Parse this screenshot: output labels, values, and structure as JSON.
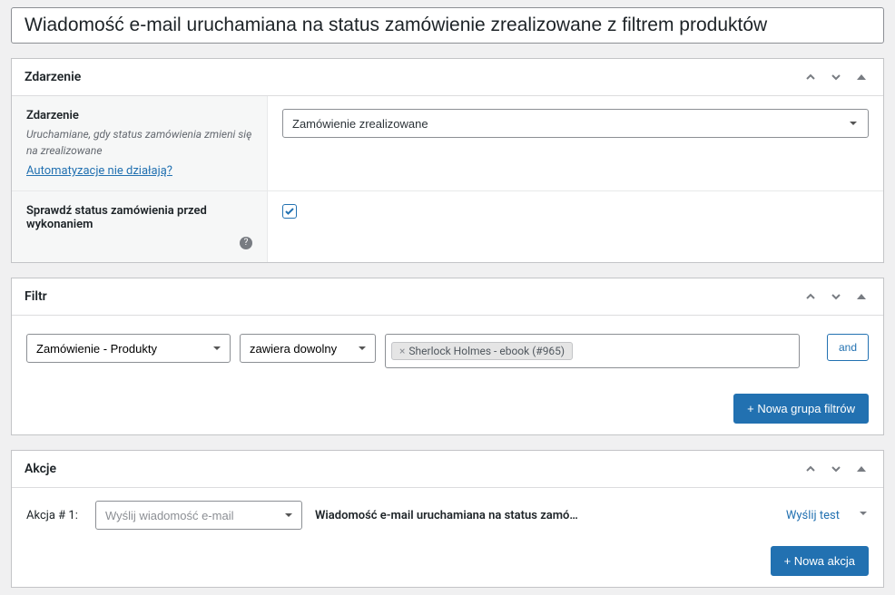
{
  "title": "Wiadomość e-mail uruchamiana na status zamówienie zrealizowane z filtrem produktów",
  "panels": {
    "event": {
      "title": "Zdarzenie",
      "field_label": "Zdarzenie",
      "field_desc": "Uruchamiane, gdy status zamówienia zmieni się na zrealizowane",
      "help_link": "Automatyzacje nie działają?",
      "selected": "Zamówienie zrealizowane",
      "check_label": "Sprawdź status zamówienia przed wykonaniem",
      "checked": true
    },
    "filter": {
      "title": "Filtr",
      "field_select": "Zamówienie - Produkty",
      "op_select": "zawiera dowolny",
      "tag": "Sherlock Holmes - ebook (#965)",
      "and_label": "and",
      "new_group": "+ Nowa grupa filtrów"
    },
    "actions": {
      "title": "Akcje",
      "row_label": "Akcja # 1:",
      "type_placeholder": "Wyślij wiadomość e-mail",
      "summary": "Wiadomość e-mail uruchamiana na status zamó…",
      "send_test": "Wyślij test",
      "new_action": "+ Nowa akcja"
    }
  }
}
